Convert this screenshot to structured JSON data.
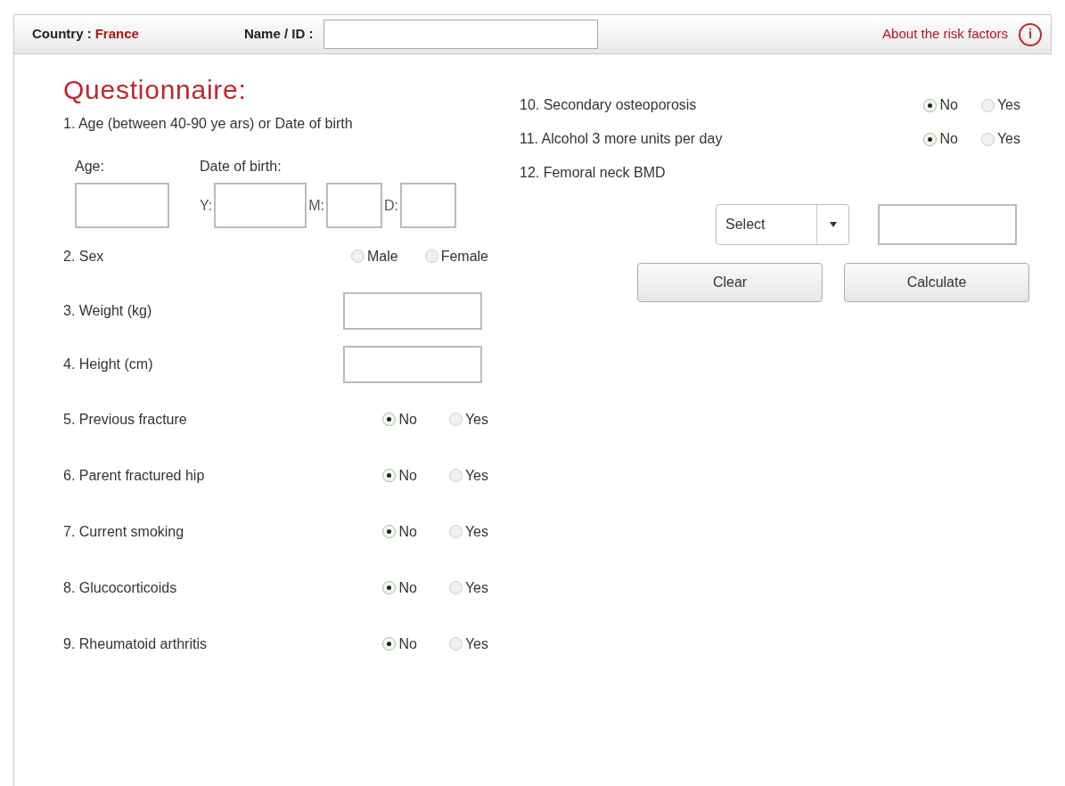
{
  "header": {
    "country_label": "Country :",
    "country_value": "France",
    "name_label": "Name / ID :",
    "about_link": "About the risk factors",
    "info_glyph": "i"
  },
  "title": "Questionnaire:",
  "left_column": [
    {
      "kind": "dob",
      "label": "1. Age (between 40-90 ye ars) or Date of birth",
      "age_label": "Age:",
      "dob_label": "Date of birth:",
      "parts": [
        "Y:",
        "M:",
        "D:"
      ]
    },
    {
      "kind": "radio",
      "label": "2. Sex",
      "options": [
        {
          "label": "Male",
          "selected": false
        },
        {
          "label": "Female",
          "selected": false
        }
      ]
    },
    {
      "kind": "input",
      "label": "3. Weight (kg)"
    },
    {
      "kind": "input",
      "label": "4. Height (cm)"
    },
    {
      "kind": "radio",
      "label": "5. Previous fracture",
      "options": [
        {
          "label": "No",
          "selected": true
        },
        {
          "label": "Yes",
          "selected": false
        }
      ]
    },
    {
      "kind": "radio",
      "label": "6. Parent fractured hip",
      "options": [
        {
          "label": "No",
          "selected": true
        },
        {
          "label": "Yes",
          "selected": false
        }
      ]
    },
    {
      "kind": "radio",
      "label": "7. Current smoking",
      "options": [
        {
          "label": "No",
          "selected": true
        },
        {
          "label": "Yes",
          "selected": false
        }
      ]
    },
    {
      "kind": "radio",
      "label": "8. Glucocorticoids",
      "options": [
        {
          "label": "No",
          "selected": true
        },
        {
          "label": "Yes",
          "selected": false
        }
      ]
    },
    {
      "kind": "radio",
      "label": "9. Rheumatoid arthritis",
      "options": [
        {
          "label": "No",
          "selected": true
        },
        {
          "label": "Yes",
          "selected": false
        }
      ]
    }
  ],
  "right_column": [
    {
      "kind": "radio",
      "label": "10. Secondary osteoporosis",
      "options": [
        {
          "label": "No",
          "selected": true
        },
        {
          "label": "Yes",
          "selected": false
        }
      ]
    },
    {
      "kind": "radio",
      "label": "11. Alcohol 3 more units per day",
      "options": [
        {
          "label": "No",
          "selected": true
        },
        {
          "label": "Yes",
          "selected": false
        }
      ]
    },
    {
      "kind": "bmd",
      "label": "12. Femoral neck BMD",
      "select_value": "Select"
    }
  ],
  "buttons": [
    "Clear",
    "Calculate"
  ]
}
